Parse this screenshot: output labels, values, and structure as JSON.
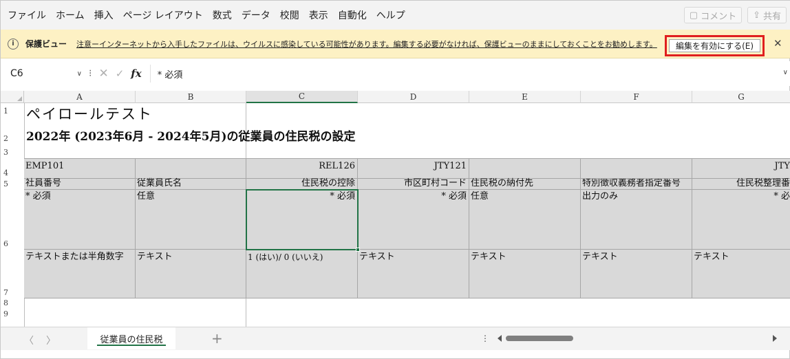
{
  "menu": {
    "items": [
      {
        "name": "menu-file",
        "label": "ファイル"
      },
      {
        "name": "menu-home",
        "label": "ホーム"
      },
      {
        "name": "menu-insert",
        "label": "挿入"
      },
      {
        "name": "menu-page-layout",
        "label": "ページ レイアウト"
      },
      {
        "name": "menu-formulas",
        "label": "数式"
      },
      {
        "name": "menu-data",
        "label": "データ"
      },
      {
        "name": "menu-review",
        "label": "校閲"
      },
      {
        "name": "menu-view",
        "label": "表示"
      },
      {
        "name": "menu-automate",
        "label": "自動化"
      },
      {
        "name": "menu-help",
        "label": "ヘルプ"
      }
    ],
    "comment_label": "コメント",
    "share_label": "共有"
  },
  "protected_view": {
    "title": "保護ビュー",
    "message": "注意ーインターネットから入手したファイルは、ウイルスに感染している可能性があります。編集する必要がなければ、保護ビューのままにしておくことをお勧めします。",
    "enable_button": "編集を有効にする(E)",
    "close_glyph": "✕",
    "highlight_color": "#e01e1e"
  },
  "formula_bar": {
    "name_box": "C6",
    "fx_label": "fx",
    "formula": "* 必須"
  },
  "grid": {
    "columns": [
      "A",
      "B",
      "C",
      "D",
      "E",
      "F",
      "G"
    ],
    "selected_column": "C",
    "rows": [
      "1",
      "2",
      "3",
      "4",
      "5",
      "6",
      "7",
      "8",
      "9"
    ],
    "title1": "ペイロールテスト",
    "title2": "2022年 (2023年6月 - 2024年5月)の従業員の住民税の設定",
    "row4": {
      "A": "EMP101",
      "C": "REL126",
      "D": "JTY121",
      "G": "JTY"
    },
    "row5": {
      "A": "社員番号",
      "B": "従業員氏名",
      "C": "住民税の控除",
      "D": "市区町村コード",
      "E": "住民税の納付先",
      "F": "特別徴収義務者指定番号",
      "G": "住民税整理番"
    },
    "row6": {
      "A": "* 必須",
      "B": "任意",
      "C": "* 必須",
      "D": "* 必須",
      "E": "任意",
      "F": "出力のみ",
      "G": "* 必"
    },
    "row7": {
      "A": "テキストまたは半角数字",
      "B": "テキスト",
      "C": "1 (はい)/ 0 (いいえ)",
      "D": "テキスト",
      "E": "テキスト",
      "F": "テキスト",
      "G": "テキスト"
    },
    "selection_color": "#217346",
    "header_fill": "#d9d9d9"
  },
  "sheets": {
    "active": "従業員の住民税",
    "add_label": "+"
  }
}
